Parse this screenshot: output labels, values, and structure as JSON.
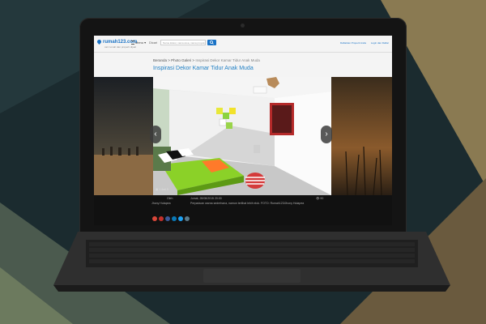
{
  "site": {
    "logo": "rumah123.com",
    "tagline": "cari rumah dan properti dijual",
    "menu_label": "Menu",
    "filter_label": "Dicari",
    "search_placeholder": "Nama lokasi, nama area, nama proyek, ID iklan",
    "header_links": [
      "Daftarkan Properti Anda",
      "Login dan Daftar"
    ]
  },
  "breadcrumb": {
    "home": "Beranda",
    "section": "Photo Galeri",
    "current": "Inspirasi Dekor Kamar Tidur Anak Muda"
  },
  "title": "Inspirasi Dekor Kamar Tidur Anak Muda",
  "gallery": {
    "count": "1 dari 8",
    "prev_icon": "chevron-left-icon",
    "next_icon": "chevron-right-icon"
  },
  "caption": {
    "author_label": "Oleh",
    "author": "Jhony Hutapea",
    "date": "Jumat, 28/08/2015 20:00",
    "text": "Perpaduan warna sederhana, namun terlihat lebih elok. FOTO: Rumah123/Jhony Hutapea",
    "views": "90"
  },
  "share_icons": [
    {
      "name": "google-plus-icon",
      "color": "#d9473a"
    },
    {
      "name": "youtube-icon",
      "color": "#c4302b"
    },
    {
      "name": "facebook-icon",
      "color": "#3b5998"
    },
    {
      "name": "linkedin-icon",
      "color": "#0a78b5"
    },
    {
      "name": "twitter-icon",
      "color": "#1da1f2"
    },
    {
      "name": "email-icon",
      "color": "#5a7a8a"
    }
  ],
  "colors": {
    "brand": "#1a73c6",
    "title": "#1f7fc4"
  }
}
